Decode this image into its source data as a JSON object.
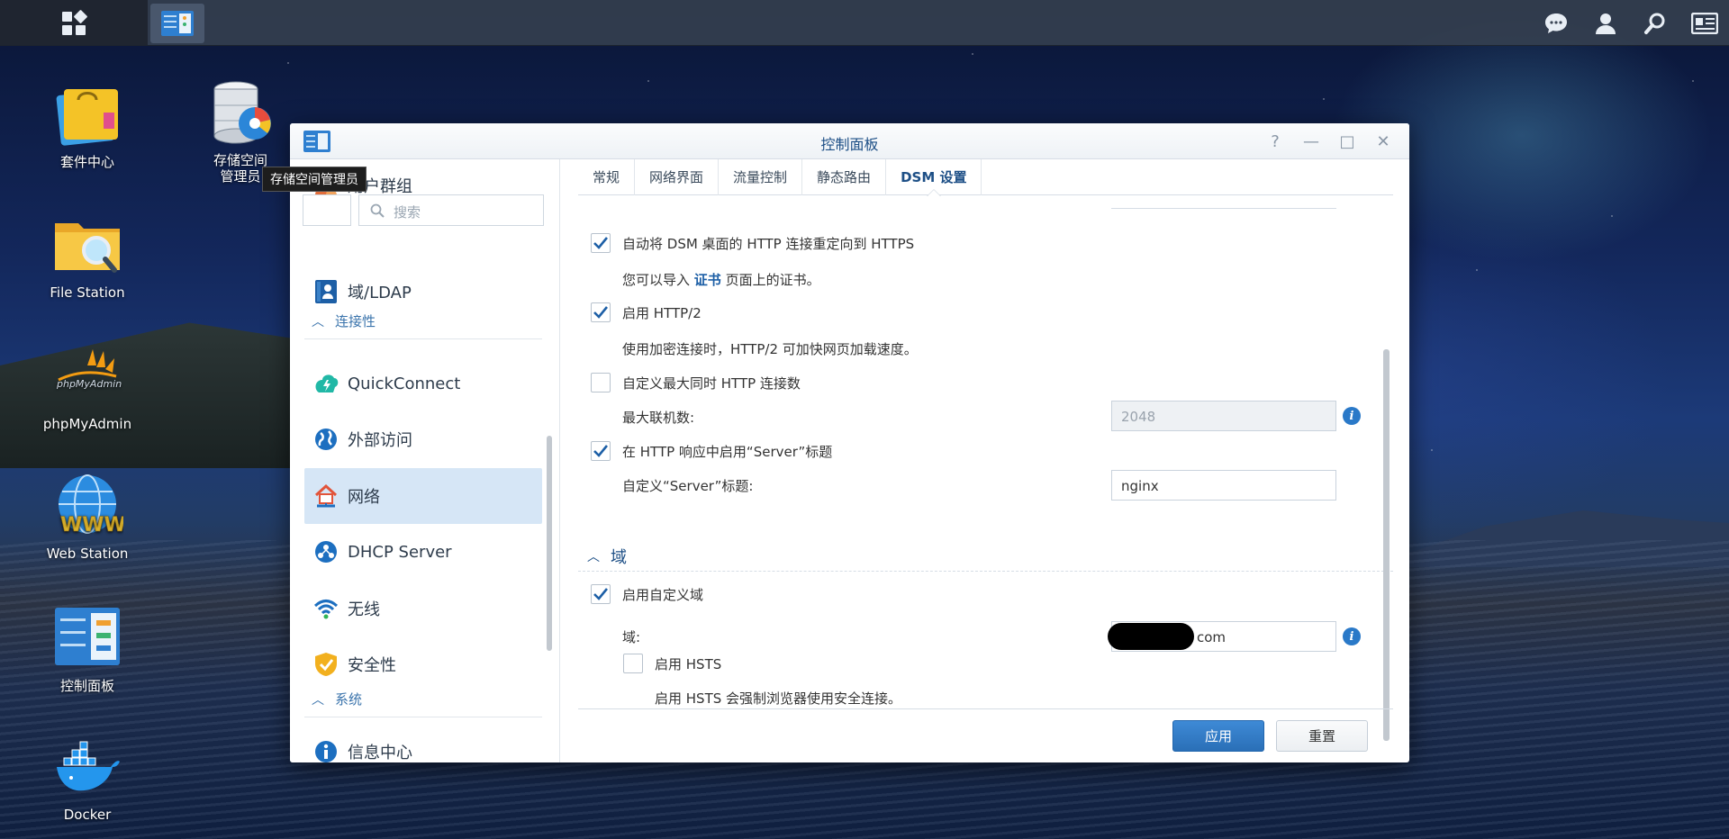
{
  "desktop": {
    "icons": [
      {
        "label": "套件中心"
      },
      {
        "label": "存储空间\n管理员"
      },
      {
        "label": "File Station"
      },
      {
        "label": "phpMyAdmin"
      },
      {
        "label": "Web Station"
      },
      {
        "label": "控制面板"
      },
      {
        "label": "Docker"
      }
    ],
    "tooltip": "存储空间管理员"
  },
  "window": {
    "title": "控制面板",
    "controls": [
      "?",
      "—",
      "□",
      "✕"
    ]
  },
  "sidebar": {
    "search_placeholder": "搜索",
    "items": [
      {
        "label": "用户群组"
      },
      {
        "label": "域/LDAP"
      },
      {
        "label": "QuickConnect"
      },
      {
        "label": "外部访问"
      },
      {
        "label": "网络"
      },
      {
        "label": "DHCP Server"
      },
      {
        "label": "无线"
      },
      {
        "label": "安全性"
      },
      {
        "label": "信息中心"
      }
    ],
    "sections": [
      {
        "label": "连接性"
      },
      {
        "label": "系统"
      }
    ]
  },
  "tabs": [
    {
      "label": "常规"
    },
    {
      "label": "网络界面"
    },
    {
      "label": "流量控制"
    },
    {
      "label": "静态路由"
    },
    {
      "label": "DSM 设置"
    }
  ],
  "settings": {
    "redirect_https": {
      "label": "自动将 DSM 桌面的 HTTP 连接重定向到 HTTPS",
      "checked": true
    },
    "cert_note_prefix": "您可以导入",
    "cert_link": "证书",
    "cert_note_suffix": "页面上的证书。",
    "http2": {
      "label": "启用 HTTP/2",
      "checked": true
    },
    "http2_note": "使用加密连接时，HTTP/2 可加快网页加载速度。",
    "max_conn": {
      "label": "自定义最大同时 HTTP 连接数",
      "checked": false
    },
    "max_conn_field_label": "最大联机数:",
    "max_conn_value": "2048",
    "server_header": {
      "label": "在 HTTP 响应中启用“Server”标题",
      "checked": true
    },
    "server_header_field_label": "自定义“Server”标题:",
    "server_header_value": "nginx",
    "domain_section": "域",
    "custom_domain": {
      "label": "启用自定义域",
      "checked": true
    },
    "domain_field_label": "域:",
    "domain_value": "com",
    "hsts": {
      "label": "启用 HSTS",
      "checked": false
    },
    "hsts_note": "启用 HSTS 会强制浏览器使用安全连接。"
  },
  "footer": {
    "apply": "应用",
    "reset": "重置"
  },
  "colors": {
    "accent": "#1d4f86",
    "primary_button": "#2a6fb7",
    "active_nav": "#d6e6f6"
  }
}
